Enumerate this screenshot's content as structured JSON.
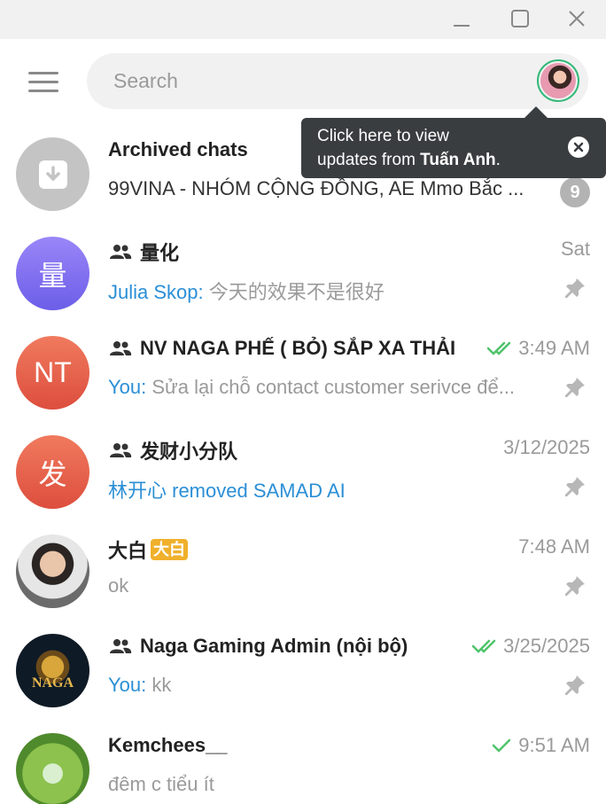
{
  "window": {
    "minimize_icon": "minimize-icon",
    "maximize_icon": "maximize-icon",
    "close_icon": "close-icon"
  },
  "header": {
    "menu_icon": "hamburger-menu-icon",
    "search_placeholder": "Search"
  },
  "tooltip": {
    "text_line1": "Click here to view",
    "text_line2_prefix": "updates from ",
    "text_line2_name": "Tuấn Anh",
    "text_line2_suffix": "."
  },
  "chats": [
    {
      "title": "Archived chats",
      "subtitle": "99VINA - NHÓM CỘNG ĐỒNG, AE Mmo Bắc ...",
      "badge": "9",
      "avatar_icon": "archive-icon"
    },
    {
      "title": "量化",
      "sender": "Julia Skop:",
      "message": " 今天的效果不是很好",
      "time": "Sat",
      "avatar_text": "量",
      "is_group": true,
      "pinned": true,
      "color": "#7b6ff0"
    },
    {
      "title": "NV NAGA PHẾ ( BỎ) SẮP XA THẢI",
      "sender": "You:",
      "message": " Sửa lại chỗ contact customer serivce để...",
      "time": "3:49 AM",
      "avatar_text": "NT",
      "is_group": true,
      "pinned": true,
      "read": "double",
      "color": "#e8614a"
    },
    {
      "title": "发财小分队",
      "sender": "林开心 removed SAMAD AI",
      "message": "",
      "time": "3/12/2025",
      "avatar_text": "发",
      "is_group": true,
      "pinned": true,
      "color": "#e8614a"
    },
    {
      "title": "大白",
      "title_tag": "大白",
      "message": "ok",
      "time": "7:48 AM",
      "pinned": true
    },
    {
      "title": "Naga Gaming Admin (nội bộ)",
      "sender": "You:",
      "message": " kk",
      "time": "3/25/2025",
      "is_group": true,
      "pinned": true,
      "read": "double"
    },
    {
      "title": "Kemchees__",
      "message": "đêm c tiểu ít",
      "time": "9:51 AM",
      "read": "single"
    }
  ],
  "colors": {
    "accent": "#2b8fd6",
    "check": "#4fc36b",
    "muted": "#9a9a9a"
  }
}
